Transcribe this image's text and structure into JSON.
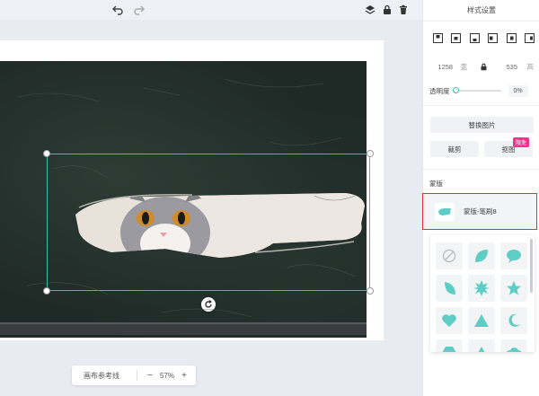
{
  "toolbar": {
    "icons": [
      "undo-icon",
      "redo-icon",
      "layers-icon",
      "lock-icon",
      "trash-icon"
    ]
  },
  "colors": {
    "accent": "#2fc4b2",
    "shape": "#5ecdc6",
    "highlight": "#e0352a",
    "badge": "#f0348b"
  },
  "canvas": {
    "guides_label": "画布参考线",
    "zoom_minus": "−",
    "zoom_value": "57%",
    "zoom_plus": "+"
  },
  "panel": {
    "title": "样式设置",
    "width_value": "1258",
    "width_unit": "宽",
    "height_value": "535",
    "height_unit": "高",
    "opacity_label": "透明度",
    "opacity_value": "0%",
    "opacity_level": 0,
    "replace_image": "替换图片",
    "crop": "裁剪",
    "cutout": "抠图",
    "cutout_badge": "限免",
    "mask_section": "蒙版",
    "current_mask": "蒙版-笔刷8",
    "mask_shapes": [
      "none",
      "leaf",
      "speech-bubble",
      "half-moon",
      "starburst",
      "star",
      "heart",
      "triangle",
      "crescent",
      "more-1",
      "more-2",
      "more-3"
    ]
  }
}
